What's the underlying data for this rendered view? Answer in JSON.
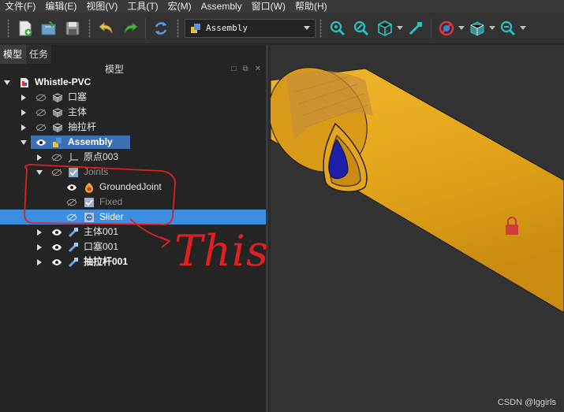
{
  "menubar": {
    "items": [
      "文件(F)",
      "编辑(E)",
      "视图(V)",
      "工具(T)",
      "宏(M)",
      "Assembly",
      "窗口(W)",
      "帮助(H)"
    ]
  },
  "toolbar": {
    "workbench_selector": "Assembly",
    "buttons": [
      "new-document-icon",
      "open-icon",
      "save-icon",
      "undo-icon",
      "redo-icon",
      "refresh-icon",
      "zoom-fit-all-icon",
      "zoom-fit-selection-icon",
      "isometric-view-icon",
      "measure-icon",
      "draw-style-icon",
      "bounding-box-icon",
      "zoom-icon"
    ]
  },
  "left_panel": {
    "tabs": [
      "模型",
      "任务"
    ],
    "title": "模型",
    "tree": [
      {
        "label": "Whistle-PVC",
        "style": "bold"
      },
      {
        "label": "口塞",
        "style": "normal"
      },
      {
        "label": "主体",
        "style": "normal"
      },
      {
        "label": "抽拉杆",
        "style": "normal"
      },
      {
        "label": "Assembly",
        "style": "bold"
      },
      {
        "label": "原点003",
        "style": "normal"
      },
      {
        "label": "Joints",
        "style": "dim"
      },
      {
        "label": "GroundedJoint",
        "style": "normal"
      },
      {
        "label": "Fixed",
        "style": "dim"
      },
      {
        "label": "Slider",
        "style": "normal"
      },
      {
        "label": "主体001",
        "style": "normal"
      },
      {
        "label": "口塞001",
        "style": "normal"
      },
      {
        "label": "抽拉杆001",
        "style": "bold"
      }
    ]
  },
  "annotation": {
    "text": "This",
    "color": "#e02020"
  },
  "viewport": {
    "part_color": "#e4a51a",
    "background": "#333333",
    "watermark": "CSDN @lggirls"
  },
  "colors": {
    "selection": "#3d8ee0",
    "assembly_highlight": "#3d6fb3"
  }
}
